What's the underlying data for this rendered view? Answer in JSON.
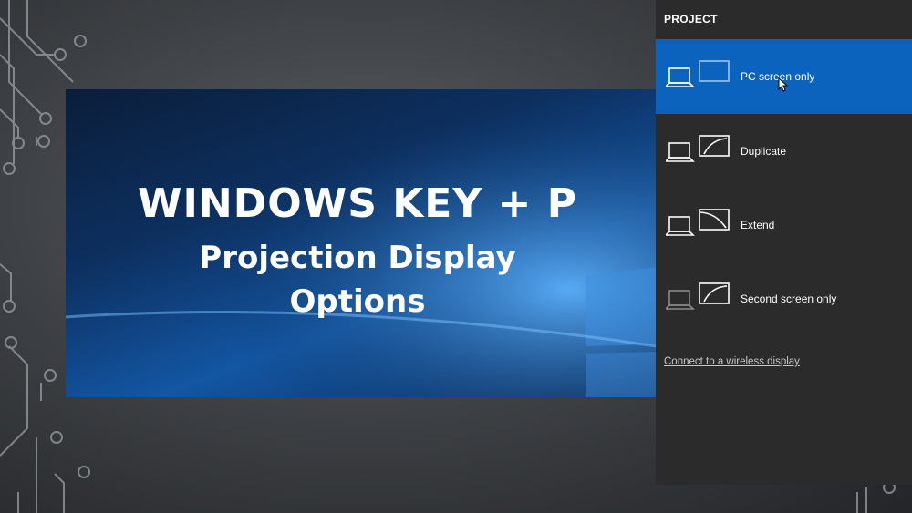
{
  "slide": {
    "line1": "WINDOWS KEY + P",
    "line2": "Projection Display",
    "line3": "Options"
  },
  "project_panel": {
    "title": "PROJECT",
    "options": [
      {
        "label": "PC screen only",
        "icon": "pc-screen-only-icon",
        "selected": true
      },
      {
        "label": "Duplicate",
        "icon": "duplicate-icon",
        "selected": false
      },
      {
        "label": "Extend",
        "icon": "extend-icon",
        "selected": false
      },
      {
        "label": "Second screen only",
        "icon": "second-screen-only-icon",
        "selected": false
      }
    ],
    "wireless_link": "Connect to a wireless display"
  },
  "colors": {
    "panel_bg": "#2b2b2b",
    "selected_bg": "#0c63bd",
    "slide_blue": "#1356a3"
  }
}
